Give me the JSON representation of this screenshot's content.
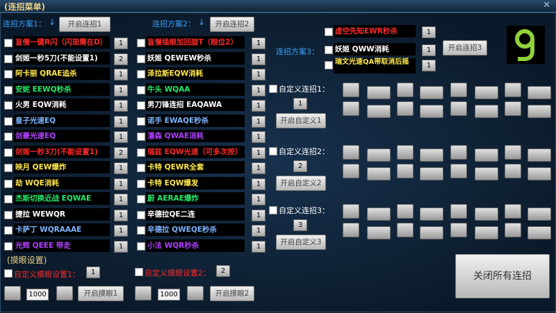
{
  "window": {
    "title": "(连招菜单)",
    "close": "✕"
  },
  "scheme1": {
    "label": "连招方案1：",
    "arrow": "↓",
    "button": "开启连招1",
    "rows": [
      {
        "text": "盲僧一键R闪（闪现需在D）",
        "color": "#ff2a2a",
        "value": "1"
      },
      {
        "text": "剑姬一秒5刀(不能设置1)",
        "color": "#ffffff",
        "value": "2"
      },
      {
        "text": "阿卡丽 QRAE追杀",
        "color": "#ffe84a",
        "value": "1"
      },
      {
        "text": "安妮 EEWQ秒杀",
        "color": "#27e86a",
        "value": "1"
      },
      {
        "text": "火男 EQW消耗",
        "color": "#ffffff",
        "value": "1"
      },
      {
        "text": "皇子光速EQ",
        "color": "#7cb4ff",
        "value": "1"
      },
      {
        "text": "剑豪光速EQ",
        "color": "#b040ff",
        "value": "1"
      },
      {
        "text": "剑姬一秒3刀(不能设置1)",
        "color": "#ff2a2a",
        "value": "2"
      },
      {
        "text": "映月 QEW爆炸",
        "color": "#ffe84a",
        "value": "1"
      },
      {
        "text": "劫 WQE消耗",
        "color": "#ffe84a",
        "value": "1"
      },
      {
        "text": "杰斯切换近战 EQWAE",
        "color": "#27e86a",
        "value": "1"
      },
      {
        "text": "捷拉 WEWQR",
        "color": "#ffffff",
        "value": "1"
      },
      {
        "text": "卡萨丁 WQRAAAE",
        "color": "#7cb4ff",
        "value": "1"
      },
      {
        "text": "光辉 QEEE 带走",
        "color": "#b040ff",
        "value": "1"
      }
    ]
  },
  "scheme2": {
    "label": "连招方案2：",
    "arrow": "↓",
    "button": "开启连招2",
    "rows": [
      {
        "text": "盲僧插眼加回旋T（眼位2）",
        "color": "#ff2a2a",
        "value": "1"
      },
      {
        "text": "妖姬 QEWEW秒杀",
        "color": "#ffffff",
        "value": "1"
      },
      {
        "text": "泽拉斯EQW消耗",
        "color": "#ffe84a",
        "value": "1"
      },
      {
        "text": "牛头 WQAA",
        "color": "#27e86a",
        "value": "1"
      },
      {
        "text": "男刀锋连招 EAQAWA",
        "color": "#ffffff",
        "value": "1"
      },
      {
        "text": "诺手 EWAQE秒杀",
        "color": "#7cb4ff",
        "value": "1"
      },
      {
        "text": "潘森 QWAE消耗",
        "color": "#b040ff",
        "value": "1"
      },
      {
        "text": "瑞兹 EQW光速（可多次按）",
        "color": "#ff2a2a",
        "value": "1"
      },
      {
        "text": "卡特 QEWR全套",
        "color": "#ffe84a",
        "value": "1"
      },
      {
        "text": "卡特 EQW爆发",
        "color": "#ffe84a",
        "value": "1"
      },
      {
        "text": "蔚 AERAE爆炸",
        "color": "#27e86a",
        "value": "1"
      },
      {
        "text": "辛德拉QE二连",
        "color": "#ffffff",
        "value": "1"
      },
      {
        "text": "辛德拉 QWEQE秒杀",
        "color": "#7cb4ff",
        "value": "1"
      },
      {
        "text": "小法 WQR秒杀",
        "color": "#b040ff",
        "value": "1"
      }
    ]
  },
  "scheme3": {
    "label": "连招方案3：",
    "button": "开启连招3",
    "rows": [
      {
        "text": "虚空先知EWR秒杀",
        "color": "#ff2a2a",
        "value": "1"
      },
      {
        "text": "妖姬 QWW消耗",
        "color": "#ffffff",
        "value": "1"
      },
      {
        "text": "瑞文光速QA带取消后摇",
        "color": "#ffe84a",
        "value": "1"
      }
    ]
  },
  "custom": [
    {
      "label": "自定义连招1：",
      "value": "1",
      "button": "开启自定义1"
    },
    {
      "label": "自定义连招2：",
      "value": "2",
      "button": "开启自定义2"
    },
    {
      "label": "自定义连招3：",
      "value": "3",
      "button": "开启自定义3"
    }
  ],
  "eye": {
    "section": "(摸眼设置)",
    "set1_label": "自定义摸眼设置1：",
    "set1_value": "1",
    "set1_delay": "1000",
    "set1_button": "开启摸眼1",
    "set2_label": "自定义摸眼设置2：",
    "set2_value": "2",
    "set2_delay": "1000",
    "set2_button": "开启摸眼2"
  },
  "close_all": "关闭所有连招",
  "colors": {
    "accent": "#39a0ff",
    "logo": "#8fd13a"
  }
}
